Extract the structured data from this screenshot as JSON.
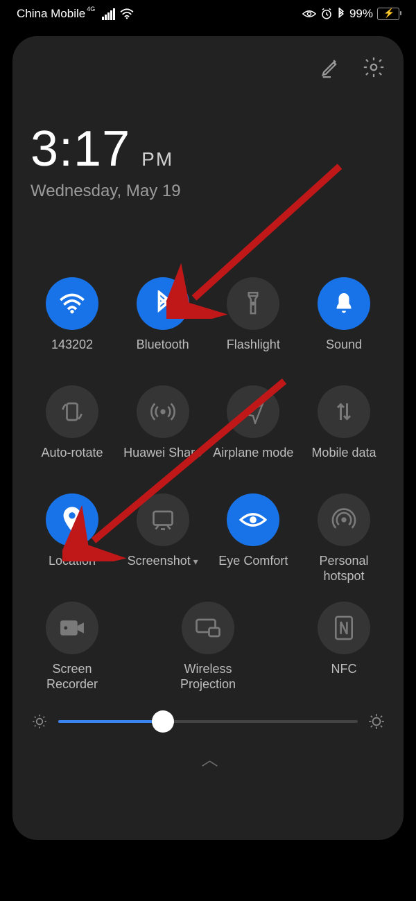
{
  "status": {
    "carrier": "China Mobile",
    "network_indicator": "4G",
    "battery_text": "99%"
  },
  "header": {
    "time": "3:17",
    "ampm": "PM",
    "date": "Wednesday, May 19"
  },
  "toggles": [
    [
      {
        "key": "wifi",
        "label": "143202",
        "active": true
      },
      {
        "key": "bluetooth",
        "label": "Bluetooth",
        "active": true
      },
      {
        "key": "flashlight",
        "label": "Flashlight",
        "active": false
      },
      {
        "key": "sound",
        "label": "Sound",
        "active": true
      }
    ],
    [
      {
        "key": "autorotate",
        "label": "Auto-rotate",
        "active": false
      },
      {
        "key": "huaweishare",
        "label": "Huawei Share",
        "active": false
      },
      {
        "key": "airplane",
        "label": "Airplane mode",
        "active": false
      },
      {
        "key": "mobiledata",
        "label": "Mobile data",
        "active": false
      }
    ],
    [
      {
        "key": "location",
        "label": "Location",
        "active": true
      },
      {
        "key": "screenshot",
        "label": "Screenshot",
        "active": false,
        "dropdown": true
      },
      {
        "key": "eyecomfort",
        "label": "Eye Comfort",
        "active": true
      },
      {
        "key": "hotspot",
        "label": "Personal hotspot",
        "active": false
      }
    ],
    [
      {
        "key": "recorder",
        "label": "Screen Recorder",
        "active": false
      },
      {
        "key": "projection",
        "label": "Wireless Projection",
        "active": false
      },
      {
        "key": "nfc",
        "label": "NFC",
        "active": false
      }
    ]
  ],
  "brightness": {
    "percent": 35
  },
  "colors": {
    "accent": "#1973e8",
    "arrow": "#c01818"
  }
}
